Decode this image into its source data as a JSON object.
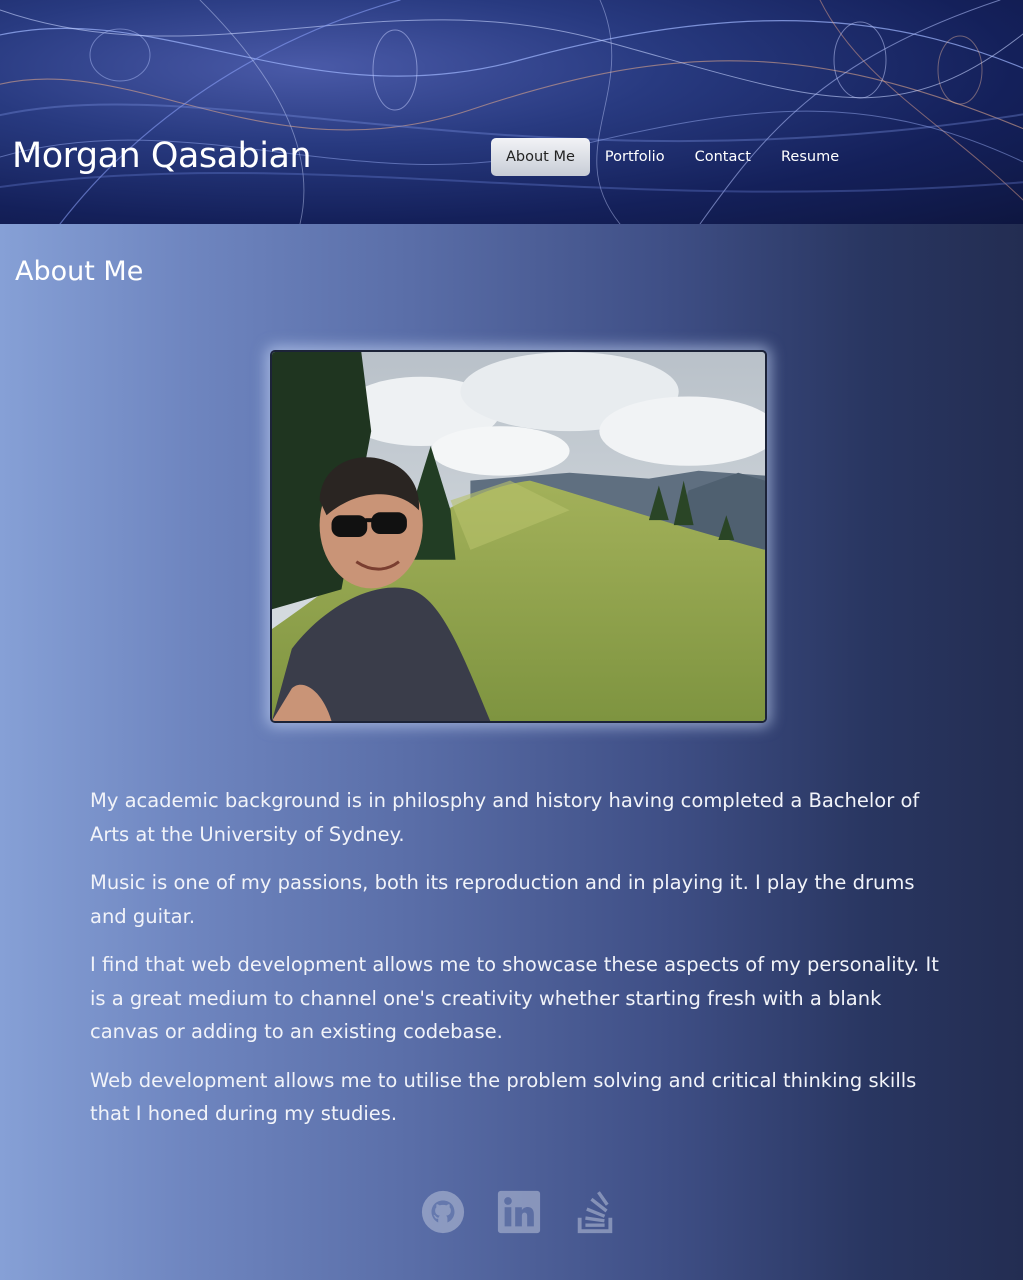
{
  "header": {
    "brand": "Morgan Qasabian",
    "nav": [
      {
        "label": "About Me",
        "active": true
      },
      {
        "label": "Portfolio",
        "active": false
      },
      {
        "label": "Contact",
        "active": false
      },
      {
        "label": "Resume",
        "active": false
      }
    ]
  },
  "about": {
    "title": "About Me",
    "paragraphs": [
      "My academic background is in philosphy and history having completed a Bachelor of Arts at the University of Sydney.",
      "Music is one of my passions, both its reproduction and in playing it. I play the drums and guitar.",
      "I find that web development allows me to showcase these aspects of my personality. It is a great medium to channel one's creativity whether starting fresh with a blank canvas or adding to an existing codebase.",
      "Web development allows me to utilise the problem solving and critical thinking skills that I honed during my studies."
    ]
  },
  "footer": {
    "social_icons": [
      "github-icon",
      "linkedin-icon",
      "stackoverflow-icon"
    ]
  },
  "colors": {
    "accent": "#ffffff",
    "header_bg": "#1a2868",
    "body_gradient_left": "#86a0d6",
    "body_gradient_right": "#232d52"
  }
}
